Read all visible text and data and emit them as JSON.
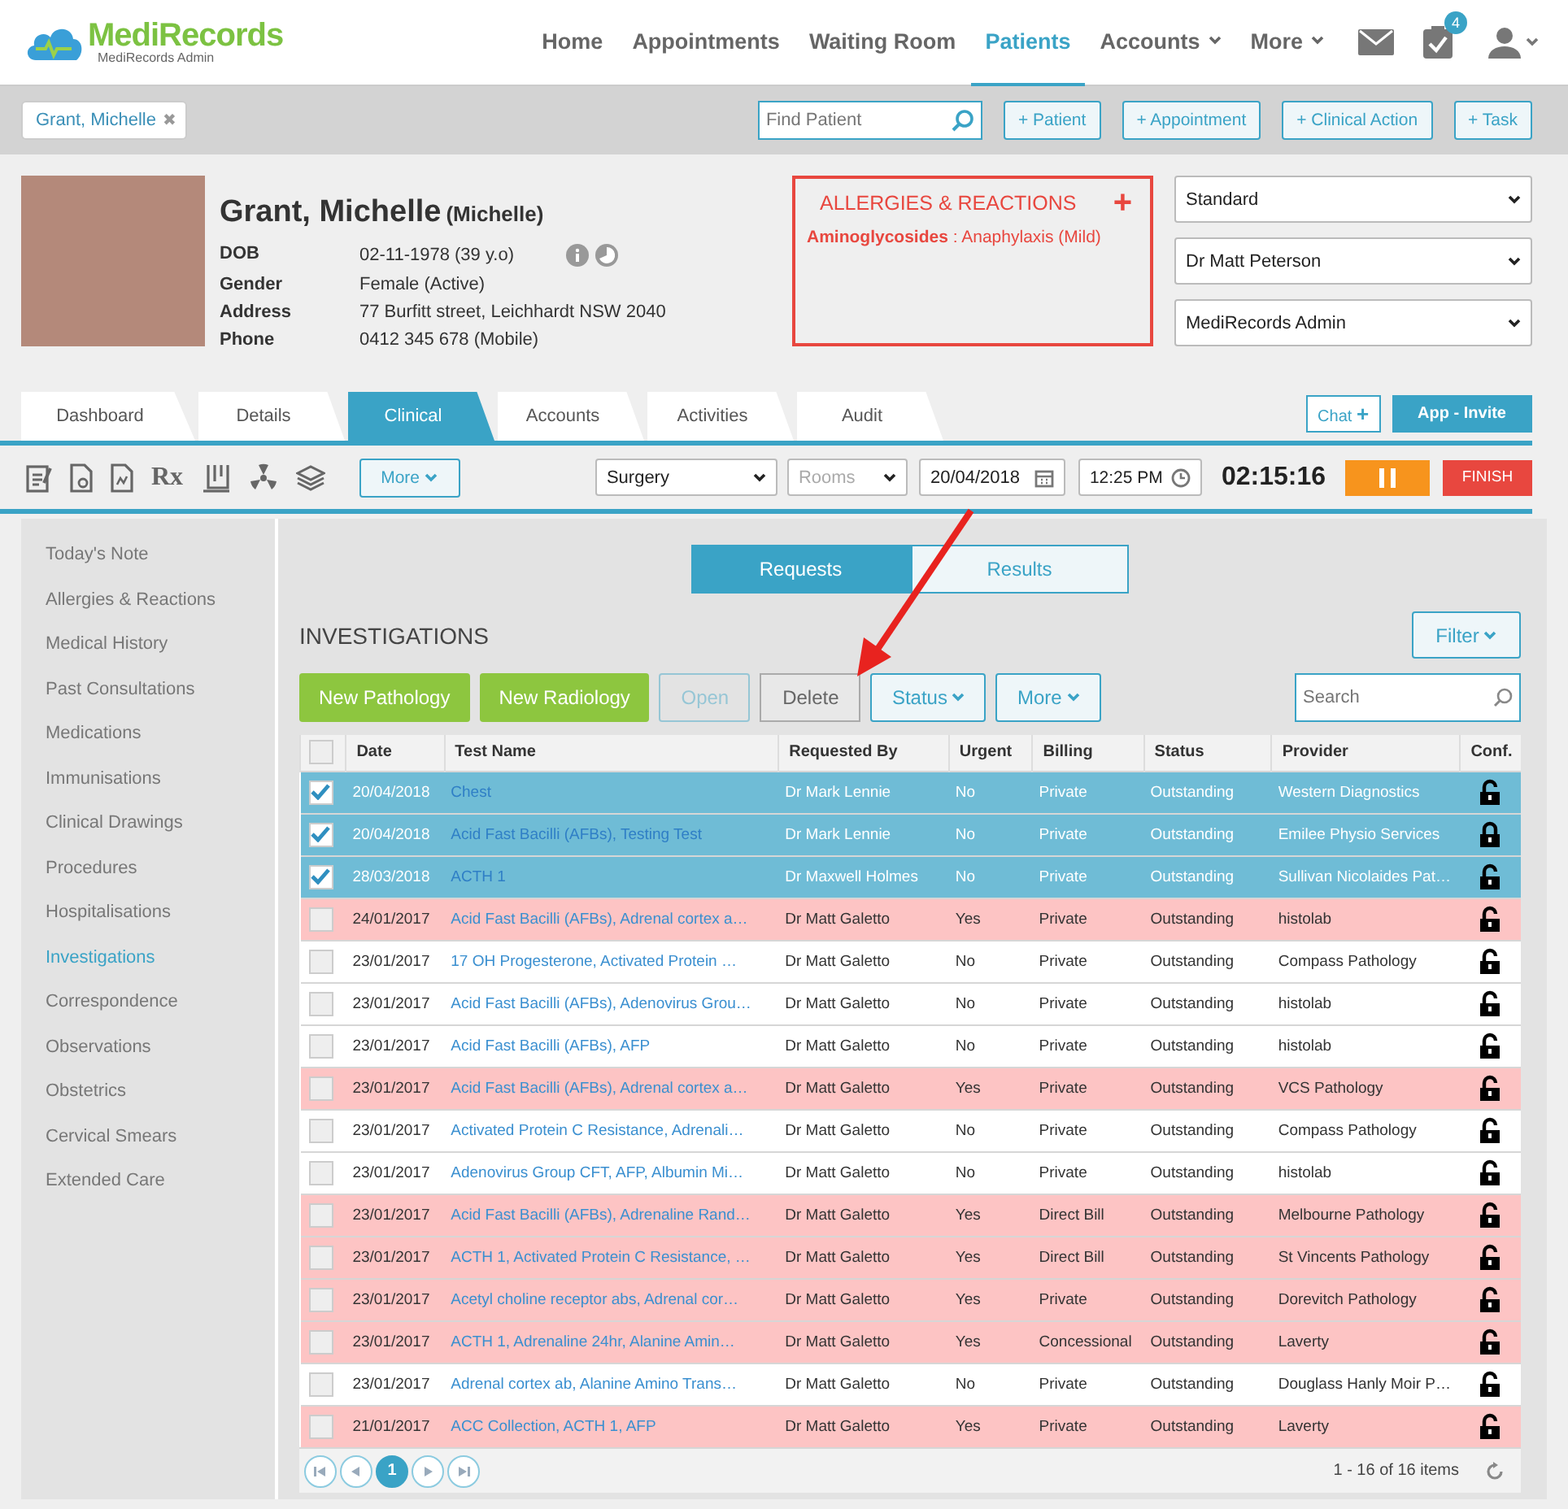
{
  "header": {
    "logo": "MediRecords",
    "logo_subtitle": "MediRecords Admin",
    "nav": [
      {
        "label": "Home",
        "selected": false,
        "dropdown": false
      },
      {
        "label": "Appointments",
        "selected": false,
        "dropdown": false
      },
      {
        "label": "Waiting Room",
        "selected": false,
        "dropdown": false
      },
      {
        "label": "Patients",
        "selected": true,
        "dropdown": false
      },
      {
        "label": "Accounts",
        "selected": false,
        "dropdown": true
      },
      {
        "label": "More",
        "selected": false,
        "dropdown": true
      }
    ],
    "task_badge": "4"
  },
  "toolbar": {
    "patient_tab": "Grant, Michelle",
    "close": "✖",
    "search": {
      "placeholder": "Find Patient"
    },
    "buttons": [
      "+ Patient",
      "+ Appointment",
      "+ Clinical Action",
      "+ Task"
    ]
  },
  "patient": {
    "name": "Grant, Michelle",
    "preferred": "(Michelle)",
    "fields": [
      {
        "label": "DOB",
        "value": "02-11-1978 (39 y.o)"
      },
      {
        "label": "Gender",
        "value": "Female (Active)"
      },
      {
        "label": "Address",
        "value": "77 Burfitt street, Leichhardt NSW 2040"
      },
      {
        "label": "Phone",
        "value": "0412 345 678 (Mobile)"
      }
    ],
    "allergies": {
      "title": "ALLERGIES & REACTIONS",
      "add": "+",
      "entries": [
        "**Aminoglycosides** : Anaphylaxis (Mild)"
      ]
    },
    "selects": [
      "Standard",
      "Dr Matt Peterson",
      "MediRecords Admin"
    ]
  },
  "tabs": [
    {
      "label": "Dashboard",
      "selected": false
    },
    {
      "label": "Details",
      "selected": false
    },
    {
      "label": "Clinical",
      "selected": true
    },
    {
      "label": "Accounts",
      "selected": false
    },
    {
      "label": "Activities",
      "selected": false
    },
    {
      "label": "Audit",
      "selected": false
    }
  ],
  "tab_buttons": {
    "chat": "Chat",
    "chat_plus": "+",
    "invite": "App - Invite"
  },
  "clinical_bar": {
    "rx": "Rx",
    "more": "More",
    "location": "Surgery",
    "rooms": {
      "placeholder": "Rooms"
    },
    "date": "20/04/2018",
    "time": "12:25 PM",
    "timer": "02:15:16",
    "finish": "FINISH"
  },
  "sidebar": {
    "items": [
      {
        "label": "Today's Note",
        "selected": false
      },
      {
        "label": "Allergies & Reactions",
        "selected": false
      },
      {
        "label": "Medical History",
        "selected": false
      },
      {
        "label": "Past Consultations",
        "selected": false
      },
      {
        "label": "Medications",
        "selected": false
      },
      {
        "label": "Immunisations",
        "selected": false
      },
      {
        "label": "Clinical Drawings",
        "selected": false
      },
      {
        "label": "Procedures",
        "selected": false
      },
      {
        "label": "Hospitalisations",
        "selected": false
      },
      {
        "label": "Investigations",
        "selected": true
      },
      {
        "label": "Correspondence",
        "selected": false
      },
      {
        "label": "Observations",
        "selected": false
      },
      {
        "label": "Obstetrics",
        "selected": false
      },
      {
        "label": "Cervical Smears",
        "selected": false
      },
      {
        "label": "Extended Care",
        "selected": false
      }
    ]
  },
  "segments": [
    {
      "label": "Requests",
      "selected": true
    },
    {
      "label": "Results",
      "selected": false
    }
  ],
  "investigations": {
    "title": "INVESTIGATIONS",
    "filter": "Filter",
    "actions": [
      {
        "label": "New Pathology",
        "kind": "primary"
      },
      {
        "label": "New Radiology",
        "kind": "primary"
      },
      {
        "label": "Open",
        "kind": "disabled"
      },
      {
        "label": "Delete",
        "kind": "plain"
      },
      {
        "label": "Status",
        "kind": "menu"
      },
      {
        "label": "More",
        "kind": "menu"
      }
    ],
    "search": {
      "placeholder": "Search"
    },
    "table": {
      "all_selected": false,
      "columns": [
        "Date",
        "Test Name",
        "Requested By",
        "Urgent",
        "Billing",
        "Status",
        "Provider",
        "Conf."
      ],
      "rows": [
        {
          "selected": true,
          "flagged": false,
          "locked": false,
          "cells": [
            "20/04/2018",
            "Chest",
            "Dr Mark Lennie",
            "No",
            "Private",
            "Outstanding",
            "Western Diagnostics"
          ]
        },
        {
          "selected": true,
          "flagged": false,
          "locked": true,
          "cells": [
            "20/04/2018",
            "Acid Fast Bacilli (AFBs), Testing Test",
            "Dr Mark Lennie",
            "No",
            "Private",
            "Outstanding",
            "Emilee Physio Services"
          ]
        },
        {
          "selected": true,
          "flagged": false,
          "locked": false,
          "cells": [
            "28/03/2018",
            "ACTH 1",
            "Dr Maxwell Holmes",
            "No",
            "Private",
            "Outstanding",
            "Sullivan Nicolaides Pat…"
          ]
        },
        {
          "selected": false,
          "flagged": true,
          "locked": false,
          "cells": [
            "24/01/2017",
            "Acid Fast Bacilli (AFBs), Adrenal cortex a…",
            "Dr Matt Galetto",
            "Yes",
            "Private",
            "Outstanding",
            "histolab"
          ]
        },
        {
          "selected": false,
          "flagged": false,
          "locked": false,
          "cells": [
            "23/01/2017",
            "17 OH Progesterone, Activated Protein …",
            "Dr Matt Galetto",
            "No",
            "Private",
            "Outstanding",
            "Compass Pathology"
          ]
        },
        {
          "selected": false,
          "flagged": false,
          "locked": false,
          "cells": [
            "23/01/2017",
            "Acid Fast Bacilli (AFBs), Adenovirus Grou…",
            "Dr Matt Galetto",
            "No",
            "Private",
            "Outstanding",
            "histolab"
          ]
        },
        {
          "selected": false,
          "flagged": false,
          "locked": false,
          "cells": [
            "23/01/2017",
            "Acid Fast Bacilli (AFBs), AFP",
            "Dr Matt Galetto",
            "No",
            "Private",
            "Outstanding",
            "histolab"
          ]
        },
        {
          "selected": false,
          "flagged": true,
          "locked": false,
          "cells": [
            "23/01/2017",
            "Acid Fast Bacilli (AFBs), Adrenal cortex a…",
            "Dr Matt Galetto",
            "Yes",
            "Private",
            "Outstanding",
            "VCS Pathology"
          ]
        },
        {
          "selected": false,
          "flagged": false,
          "locked": false,
          "cells": [
            "23/01/2017",
            "Activated Protein C Resistance, Adrenali…",
            "Dr Matt Galetto",
            "No",
            "Private",
            "Outstanding",
            "Compass Pathology"
          ]
        },
        {
          "selected": false,
          "flagged": false,
          "locked": false,
          "cells": [
            "23/01/2017",
            "Adenovirus Group CFT, AFP, Albumin Mi…",
            "Dr Matt Galetto",
            "No",
            "Private",
            "Outstanding",
            "histolab"
          ]
        },
        {
          "selected": false,
          "flagged": true,
          "locked": false,
          "cells": [
            "23/01/2017",
            "Acid Fast Bacilli (AFBs), Adrenaline Rand…",
            "Dr Matt Galetto",
            "Yes",
            "Direct Bill",
            "Outstanding",
            "Melbourne Pathology"
          ]
        },
        {
          "selected": false,
          "flagged": true,
          "locked": false,
          "cells": [
            "23/01/2017",
            "ACTH 1, Activated Protein C Resistance, …",
            "Dr Matt Galetto",
            "Yes",
            "Direct Bill",
            "Outstanding",
            "St Vincents Pathology"
          ]
        },
        {
          "selected": false,
          "flagged": true,
          "locked": false,
          "cells": [
            "23/01/2017",
            "Acetyl choline receptor abs, Adrenal cor…",
            "Dr Matt Galetto",
            "Yes",
            "Private",
            "Outstanding",
            "Dorevitch Pathology"
          ]
        },
        {
          "selected": false,
          "flagged": true,
          "locked": false,
          "cells": [
            "23/01/2017",
            "ACTH 1, Adrenaline 24hr, Alanine Amin…",
            "Dr Matt Galetto",
            "Yes",
            "Concessional",
            "Outstanding",
            "Laverty"
          ]
        },
        {
          "selected": false,
          "flagged": false,
          "locked": false,
          "cells": [
            "23/01/2017",
            "Adrenal cortex ab, Alanine Amino Trans…",
            "Dr Matt Galetto",
            "No",
            "Private",
            "Outstanding",
            "Douglass Hanly Moir P…"
          ]
        },
        {
          "selected": false,
          "flagged": true,
          "locked": false,
          "cells": [
            "21/01/2017",
            "ACC Collection, ACTH 1, AFP",
            "Dr Matt Galetto",
            "Yes",
            "Private",
            "Outstanding",
            "Laverty"
          ]
        }
      ]
    },
    "pager": {
      "pages": [
        {
          "label": "1",
          "selected": true
        }
      ],
      "summary": "1 - 16 of 16 items"
    }
  }
}
